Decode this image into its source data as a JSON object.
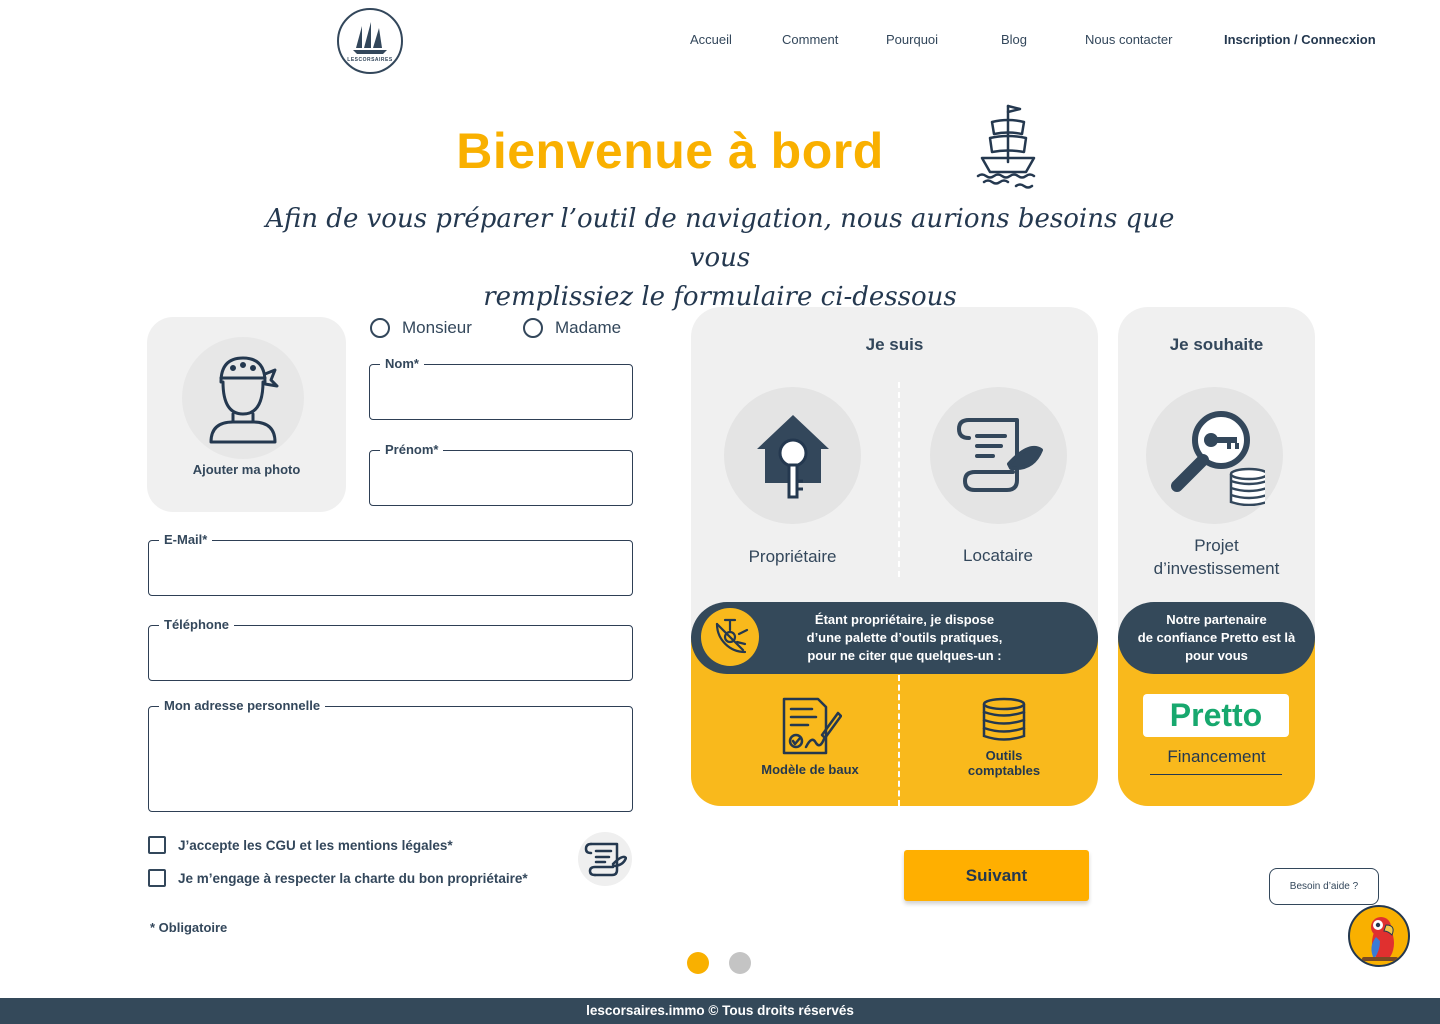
{
  "header": {
    "logo_text": "LESCORSAIRES",
    "nav": {
      "home": "Accueil",
      "how": "Comment",
      "why": "Pourquoi",
      "blog": "Blog",
      "contact": "Nous contacter",
      "auth": "Inscription / Connecxion"
    }
  },
  "hero": {
    "title": "Bienvenue à bord",
    "subtitle_line1": "Afin de vous préparer l’outil de navigation, nous aurions besoins que vous",
    "subtitle_line2": "remplissiez le formulaire ci-dessous"
  },
  "form": {
    "photo_label": "Ajouter ma photo",
    "civility": {
      "mister": "Monsieur",
      "madam": "Madame"
    },
    "fields": {
      "lastname": "Nom*",
      "firstname": "Prénom*",
      "email": "E-Mail*",
      "phone": "Téléphone",
      "address": "Mon adresse personnelle"
    },
    "checkboxes": {
      "cgu": "J’accepte les CGU et les mentions légales*",
      "charter": "Je m’engage à respecter la charte du bon propriétaire*"
    },
    "required_note": "* Obligatoire"
  },
  "profile_panel": {
    "title": "Je suis",
    "owner": "Propriétaire",
    "tenant": "Locataire",
    "info_line1": "Étant propriétaire, je dispose",
    "info_line2": "d’une palette d’outils pratiques,",
    "info_line3": "pour ne citer que quelques-un :",
    "tool_lease": "Modèle de baux",
    "tool_accounting_line1": "Outils",
    "tool_accounting_line2": "comptables"
  },
  "wish_panel": {
    "title": "Je souhaite",
    "project_line1": "Projet",
    "project_line2": "d’investissement",
    "info_line1": "Notre partenaire",
    "info_line2": "de confiance Pretto est là",
    "info_line3": "pour vous",
    "partner_name": "Pretto",
    "partner_sub": "Financement"
  },
  "actions": {
    "next": "Suivant"
  },
  "pagination": {
    "current": 1,
    "total": 2,
    "active_color": "#f9b000",
    "inactive_color": "#c4c4c4"
  },
  "help": {
    "bubble": "Besoin d’aide ?"
  },
  "footer": {
    "text": "lescorsaires.immo © Tous droits réservés"
  },
  "colors": {
    "accent": "#f9b000",
    "navy": "#24384f",
    "dark_pill": "#34495a",
    "panel_bg": "#f0f0f0",
    "partner_green": "#17a86e"
  }
}
